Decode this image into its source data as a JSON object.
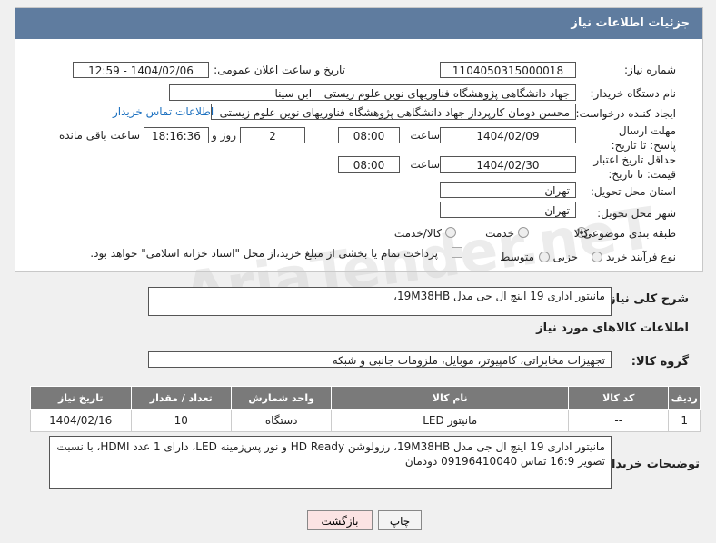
{
  "header": {
    "title": "جزئیات اطلاعات نیاز"
  },
  "fields": {
    "need_number_label": "شماره نیاز:",
    "need_number": "1104050315000018",
    "announce_label": "تاریخ و ساعت اعلان عمومی:",
    "announce_value": "1404/02/06 - 12:59",
    "buyer_label": "نام دستگاه خریدار:",
    "buyer_value": "جهاد دانشگاهی پژوهشگاه فناوریهای نوین علوم زیستی – ابن سینا",
    "creator_label": "ایجاد کننده درخواست:",
    "creator_value": "محسن دومان کارپرداز جهاد دانشگاهی پژوهشگاه فناوریهای نوین علوم زیستی",
    "contact_link": "اطلاعات تماس خریدار",
    "deadline_label": "مهلت ارسال پاسخ: تا تاریخ:",
    "deadline_date": "1404/02/09",
    "time_label": "ساعت",
    "deadline_time": "08:00",
    "days_value": "2",
    "days_label": "روز و",
    "remaining_time": "18:16:36",
    "remaining_label": "ساعت باقی مانده",
    "validity_label": "حداقل تاریخ اعتبار قیمت: تا تاریخ:",
    "validity_date": "1404/02/30",
    "validity_time": "08:00",
    "province_label": "استان محل تحویل:",
    "province_value": "تهران",
    "city_label": "شهر محل تحویل:",
    "city_value": "تهران",
    "category_label": "طبقه بندی موضوعی:",
    "category_options": [
      "کالا",
      "خدمت",
      "کالا/خدمت"
    ],
    "process_label": "نوع فرآیند خرید :",
    "process_options": [
      "جزیی",
      "متوسط"
    ],
    "payment_note": "پرداخت تمام یا بخشی از مبلغ خرید،از محل \"اسناد خزانه اسلامی\" خواهد بود."
  },
  "summary": {
    "label": "شرح کلی نیاز:",
    "value": "مانیتور اداری 19 اینچ ال جی مدل 19M38HB،"
  },
  "goods_section": {
    "title": "اطلاعات کالاهای مورد نیاز",
    "group_label": "گروه کالا:",
    "group_value": "تجهیزات مخابراتی، کامپیوتر، موبایل، ملزومات جانبی و شبکه"
  },
  "table": {
    "headers": [
      "ردیف",
      "کد کالا",
      "نام کالا",
      "واحد شمارش",
      "تعداد / مقدار",
      "تاریخ نیاز"
    ],
    "rows": [
      [
        "1",
        "--",
        "مانیتور LED",
        "دستگاه",
        "10",
        "1404/02/16"
      ]
    ]
  },
  "buyer_notes": {
    "label": "توضیحات خریدار:",
    "value": "مانیتور اداری 19 اینچ ال جی مدل 19M38HB، رزولوشن HD Ready و نور پس‌زمینه LED، دارای 1 عدد HDMI، با نسبت تصویر 16:9 تماس 09196410040 دودمان"
  },
  "buttons": {
    "print": "چاپ",
    "back": "بازگشت"
  },
  "watermark": "AriaTender.neT",
  "colors": {
    "header_bg": "#5f7c9f",
    "table_head_bg": "#7a7a7a",
    "link": "#1a6fbf",
    "back_btn_bg": "#fbe3e3"
  }
}
